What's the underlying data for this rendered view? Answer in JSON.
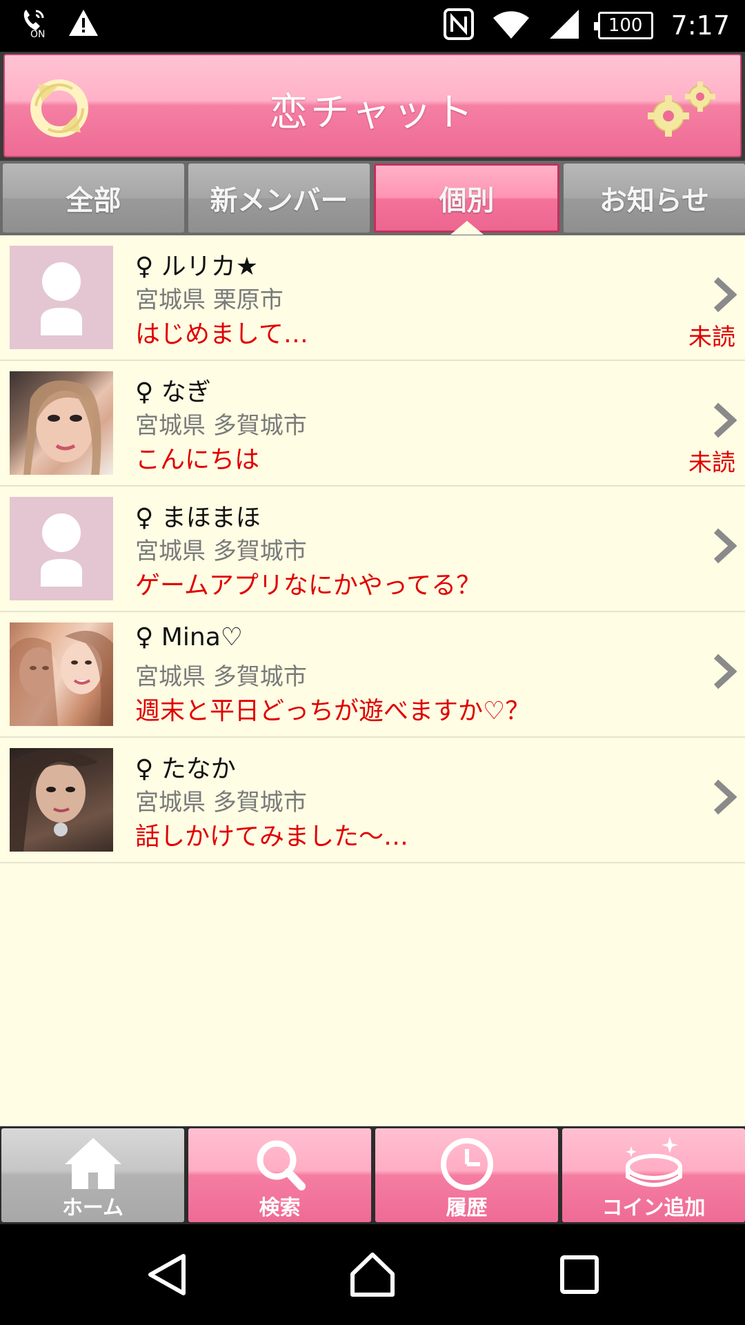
{
  "status_bar": {
    "left_icons": [
      "phone-signal-on-icon",
      "warning-icon"
    ],
    "right_icons": [
      "nfc-icon",
      "wifi-icon",
      "cellular-signal-icon"
    ],
    "battery": "100",
    "time": "7:17",
    "vibrate_label": "ON"
  },
  "header": {
    "title": "恋チャット",
    "left_icon": "refresh-icon",
    "right_icon": "settings-gears-icon"
  },
  "tabs": [
    {
      "label": "全部",
      "active": false
    },
    {
      "label": "新メンバー",
      "active": false
    },
    {
      "label": "個別",
      "active": true
    },
    {
      "label": "お知らせ",
      "active": false
    }
  ],
  "messages": [
    {
      "name": "♀ ルリカ★",
      "location": "宮城県 栗原市",
      "message": "はじめまして…",
      "unread": "未読",
      "avatar": "placeholder"
    },
    {
      "name": "♀ なぎ",
      "location": "宮城県 多賀城市",
      "message": "こんにちは",
      "unread": "未読",
      "avatar": "photo"
    },
    {
      "name": "♀ まほまほ",
      "location": "宮城県 多賀城市",
      "message": "ゲームアプリなにかやってる？",
      "unread": "",
      "avatar": "placeholder"
    },
    {
      "name": "♀ Mina♡",
      "location": "宮城県 多賀城市",
      "message": "週末と平日どっちが遊べますか♡？",
      "unread": "",
      "avatar": "photo"
    },
    {
      "name": "♀ たなか",
      "location": "宮城県 多賀城市",
      "message": "話しかけてみました〜…",
      "unread": "",
      "avatar": "photo"
    }
  ],
  "bottom_nav": [
    {
      "label": "ホーム",
      "icon": "home-icon",
      "active": true
    },
    {
      "label": "検索",
      "icon": "search-icon",
      "active": false
    },
    {
      "label": "履歴",
      "icon": "history-clock-icon",
      "active": false
    },
    {
      "label": "コイン追加",
      "icon": "coin-add-icon",
      "active": false
    }
  ],
  "colors": {
    "accent_pink": "#ee6b95",
    "list_background": "#fffde4",
    "message_red": "#e00000",
    "location_gray": "#7a7a7a"
  }
}
